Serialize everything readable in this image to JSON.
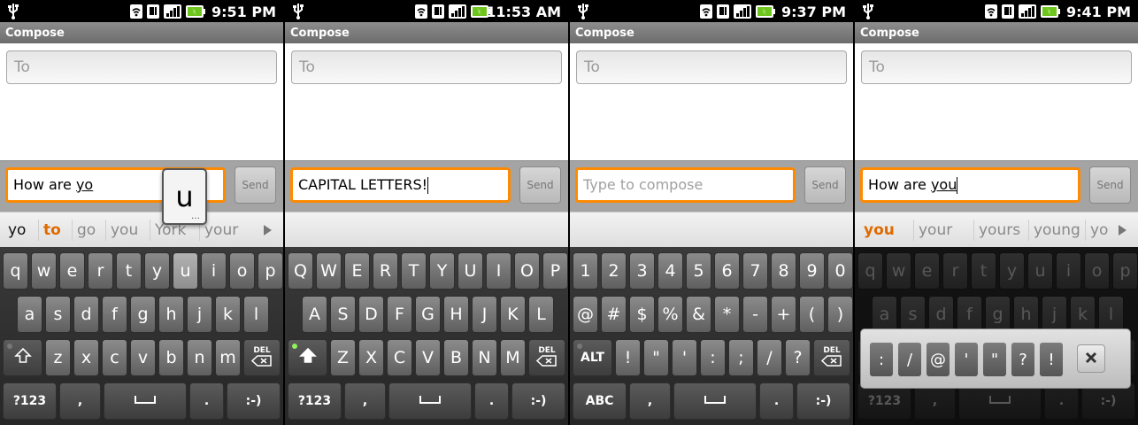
{
  "panels": [
    {
      "time": "9:51 PM",
      "title": "Compose",
      "to_placeholder": "To",
      "message_prefix": "How are ",
      "message_underlined": "yo",
      "message_is_placeholder": false,
      "send_label": "Send",
      "candidates": [
        {
          "text": "yo",
          "style": "first"
        },
        {
          "text": "to",
          "style": "highlight"
        },
        {
          "text": "go",
          "style": "normal"
        },
        {
          "text": "you",
          "style": "normal"
        },
        {
          "text": "York",
          "style": "normal"
        },
        {
          "text": "your",
          "style": "normal"
        }
      ],
      "has_candidate_arrow": true,
      "key_preview": "u",
      "keyboard_mode": "letters_lower",
      "pressed_key": "u",
      "shift_state": "off"
    },
    {
      "time": "11:53 AM",
      "title": "Compose",
      "to_placeholder": "To",
      "message_prefix": "CAPITAL LETTERS!",
      "message_underlined": "",
      "message_is_placeholder": false,
      "show_caret": true,
      "send_label": "Send",
      "candidates": [],
      "has_candidate_arrow": false,
      "keyboard_mode": "letters_upper",
      "shift_state": "locked"
    },
    {
      "time": "9:37 PM",
      "title": "Compose",
      "to_placeholder": "To",
      "message_prefix": "Type to compose",
      "message_underlined": "",
      "message_is_placeholder": true,
      "send_label": "Send",
      "candidates": [],
      "has_candidate_arrow": false,
      "keyboard_mode": "symbols",
      "shift_state": "off"
    },
    {
      "time": "9:41 PM",
      "title": "Compose",
      "to_placeholder": "To",
      "message_prefix": "How are ",
      "message_underlined": "you",
      "message_is_placeholder": false,
      "show_caret": true,
      "send_label": "Send",
      "candidates": [
        {
          "text": "you",
          "style": "highlight"
        },
        {
          "text": "your",
          "style": "normal"
        },
        {
          "text": "yours",
          "style": "normal"
        },
        {
          "text": "young",
          "style": "normal"
        },
        {
          "text": "you",
          "style": "normal"
        }
      ],
      "has_candidate_arrow": true,
      "keyboard_mode": "letters_lower",
      "dimmed": true,
      "shift_state": "off",
      "popup_keys": [
        ":",
        "/",
        "@",
        "'",
        "\"",
        "?",
        "!"
      ],
      "popup_close_icon": "close-x-icon"
    }
  ],
  "keyboards": {
    "letters_lower": {
      "row1": [
        "q",
        "w",
        "e",
        "r",
        "t",
        "y",
        "u",
        "i",
        "o",
        "p"
      ],
      "row2": [
        "a",
        "s",
        "d",
        "f",
        "g",
        "h",
        "j",
        "k",
        "l"
      ],
      "row3": [
        "z",
        "x",
        "c",
        "v",
        "b",
        "n",
        "m"
      ],
      "mode_key": "?123",
      "comma": ",",
      "period": ".",
      "smiley": ":-)",
      "del_label": "DEL"
    },
    "letters_upper": {
      "row1": [
        "Q",
        "W",
        "E",
        "R",
        "T",
        "Y",
        "U",
        "I",
        "O",
        "P"
      ],
      "row2": [
        "A",
        "S",
        "D",
        "F",
        "G",
        "H",
        "J",
        "K",
        "L"
      ],
      "row3": [
        "Z",
        "X",
        "C",
        "V",
        "B",
        "N",
        "M"
      ],
      "mode_key": "?123",
      "comma": ",",
      "period": ".",
      "smiley": ":-)",
      "del_label": "DEL"
    },
    "symbols": {
      "row1": [
        "1",
        "2",
        "3",
        "4",
        "5",
        "6",
        "7",
        "8",
        "9",
        "0"
      ],
      "row2": [
        "@",
        "#",
        "$",
        "%",
        "&",
        "*",
        "-",
        "+",
        "(",
        ")"
      ],
      "row3": [
        "!",
        "\"",
        "'",
        ":",
        ";",
        "/",
        "?"
      ],
      "alt_label": "ALT",
      "mode_key": "ABC",
      "comma": ",",
      "period": ".",
      "smiley": ":-)",
      "del_label": "DEL"
    }
  },
  "icons": {
    "usb": "usb-icon",
    "wifi": "wifi-icon",
    "sim": "sim-icon",
    "signal": "signal-icon",
    "battery": "battery-charging-icon",
    "shift": "shift-arrow-icon",
    "delete": "backspace-icon",
    "space": "space-bar-icon",
    "candidate_more": "candidate-more-arrow-icon"
  },
  "colors": {
    "focus_border": "#ff8a00",
    "candidate_highlight": "#e06a00",
    "shift_lock_indicator": "#8ff25a",
    "battery": "#6ec61c"
  }
}
